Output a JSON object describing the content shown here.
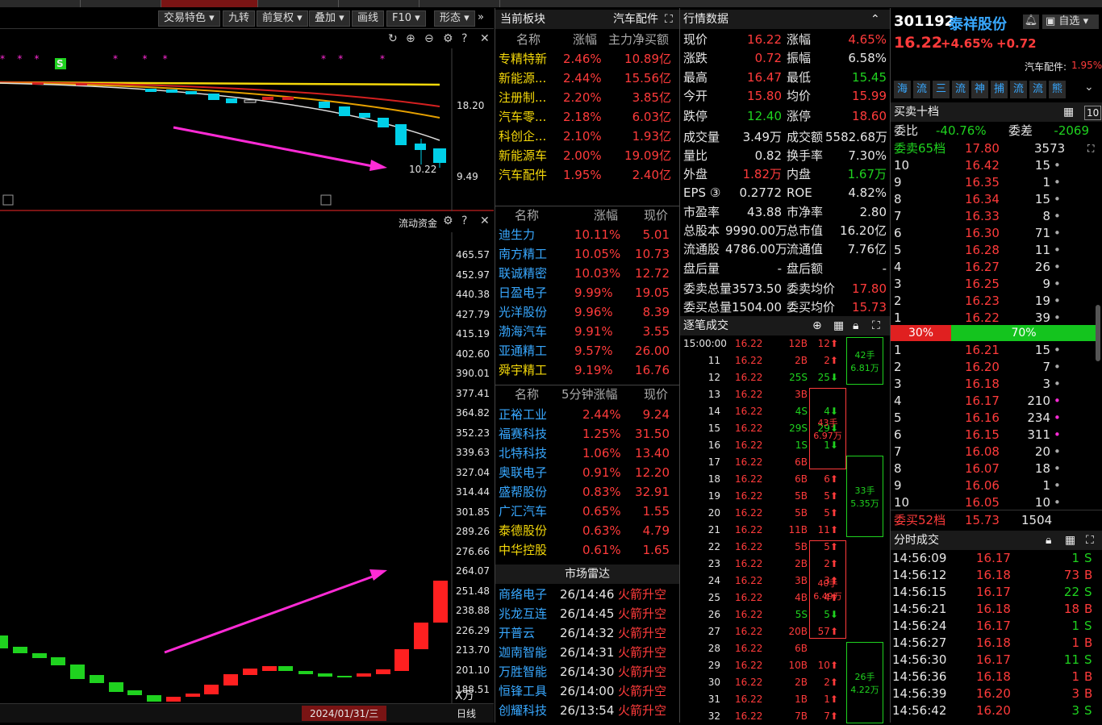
{
  "chart_toolbar": {
    "buttons": [
      "交易特色 ▾",
      "九转",
      "前复权 ▾",
      "叠加 ▾",
      "画线",
      "F10 ▾",
      "形态 ▾"
    ],
    "more": "»"
  },
  "kline": {
    "price_high": "18.20",
    "price_low": "9.49",
    "low_label": "10.22",
    "signal": "S",
    "scale_left_axis": true
  },
  "flow": {
    "title": "流动资金",
    "axis": [
      "465.57",
      "452.97",
      "440.38",
      "427.79",
      "415.19",
      "402.60",
      "390.01",
      "377.41",
      "364.82",
      "352.23",
      "339.63",
      "327.04",
      "314.44",
      "301.85",
      "289.26",
      "276.66",
      "264.07",
      "251.48",
      "238.88",
      "226.29",
      "213.70",
      "201.10",
      "188.51"
    ],
    "unit": "X万"
  },
  "bottom": {
    "date": "2024/01/31/三",
    "period": "日线"
  },
  "sector": {
    "title": "当前板块",
    "current": "汽车配件",
    "cols": [
      "名称",
      "涨幅",
      "主力净买额"
    ],
    "rows": [
      [
        "专精特新",
        "2.46%",
        "10.89亿"
      ],
      [
        "新能源...",
        "2.44%",
        "15.56亿"
      ],
      [
        "注册制...",
        "2.20%",
        "3.85亿"
      ],
      [
        "汽车零...",
        "2.18%",
        "6.03亿"
      ],
      [
        "科创企...",
        "2.10%",
        "1.93亿"
      ],
      [
        "新能源车",
        "2.00%",
        "19.09亿"
      ],
      [
        "汽车配件",
        "1.95%",
        "2.40亿"
      ]
    ]
  },
  "top_gainers": {
    "cols": [
      "名称",
      "涨幅",
      "现价"
    ],
    "rows": [
      [
        "迪生力",
        "10.11%",
        "5.01"
      ],
      [
        "南方精工",
        "10.05%",
        "10.73"
      ],
      [
        "联诚精密",
        "10.03%",
        "12.72"
      ],
      [
        "日盈电子",
        "9.99%",
        "19.05"
      ],
      [
        "光洋股份",
        "9.96%",
        "8.39"
      ],
      [
        "渤海汽车",
        "9.91%",
        "3.55"
      ],
      [
        "亚通精工",
        "9.57%",
        "26.00"
      ],
      [
        "舜宇精工",
        "9.19%",
        "16.76"
      ]
    ]
  },
  "five_min": {
    "cols": [
      "名称",
      "5分钟涨幅",
      "现价"
    ],
    "rows": [
      [
        "正裕工业",
        "2.44%",
        "9.24"
      ],
      [
        "福赛科技",
        "1.25%",
        "31.50"
      ],
      [
        "北特科技",
        "1.06%",
        "13.40"
      ],
      [
        "奥联电子",
        "0.91%",
        "12.20"
      ],
      [
        "盛帮股份",
        "0.83%",
        "32.91"
      ],
      [
        "广汇汽车",
        "0.65%",
        "1.55"
      ],
      [
        "泰德股份",
        "0.63%",
        "4.79"
      ],
      [
        "中华控股",
        "0.61%",
        "1.65"
      ]
    ]
  },
  "radar": {
    "title": "市场雷达",
    "rows": [
      [
        "商络电子",
        "26/14:46",
        "火箭升空"
      ],
      [
        "兆龙互连",
        "26/14:45",
        "火箭升空"
      ],
      [
        "开普云",
        "26/14:32",
        "火箭升空"
      ],
      [
        "迦南智能",
        "26/14:31",
        "火箭升空"
      ],
      [
        "万胜智能",
        "26/14:30",
        "火箭升空"
      ],
      [
        "恒锋工具",
        "26/14:00",
        "火箭升空"
      ],
      [
        "创耀科技",
        "26/13:54",
        "火箭升空"
      ]
    ]
  },
  "quote": {
    "title": "行情数据",
    "rows": [
      [
        "现价",
        "16.22",
        "涨幅",
        "4.65%"
      ],
      [
        "涨跌",
        "0.72",
        "振幅",
        "6.58%"
      ],
      [
        "最高",
        "16.47",
        "最低",
        "15.45"
      ],
      [
        "今开",
        "15.80",
        "均价",
        "15.99"
      ],
      [
        "跌停",
        "12.40",
        "涨停",
        "18.60"
      ],
      [
        "成交量",
        "3.49万",
        "成交额",
        "5582.68万"
      ],
      [
        "量比",
        "0.82",
        "换手率",
        "7.30%"
      ],
      [
        "外盘",
        "1.82万",
        "内盘",
        "1.67万"
      ],
      [
        "EPS ③",
        "0.2772",
        "ROE",
        "4.82%"
      ],
      [
        "市盈率",
        "43.88",
        "市净率",
        "2.80"
      ],
      [
        "总股本",
        "9990.00万",
        "总市值",
        "16.20亿"
      ],
      [
        "流通股",
        "4786.00万",
        "流通值",
        "7.76亿"
      ],
      [
        "盘后量",
        "-",
        "盘后额",
        "-"
      ],
      [
        "委卖总量",
        "3573.50",
        "委卖均价",
        "17.80"
      ],
      [
        "委买总量",
        "1504.00",
        "委买均价",
        "15.73"
      ]
    ]
  },
  "ticks": {
    "title": "逐笔成交",
    "rows": [
      [
        "15:00:00",
        "16.22",
        "12B",
        "12⬆"
      ],
      [
        "11",
        "16.22",
        "2B",
        "2⬆"
      ],
      [
        "12",
        "16.22",
        "25S",
        "25⬇"
      ],
      [
        "13",
        "16.22",
        "3B",
        ""
      ],
      [
        "14",
        "16.22",
        "4S",
        "4⬇"
      ],
      [
        "15",
        "16.22",
        "29S",
        "29⬇"
      ],
      [
        "16",
        "16.22",
        "1S",
        "1⬇"
      ],
      [
        "17",
        "16.22",
        "6B",
        ""
      ],
      [
        "18",
        "16.22",
        "6B",
        "6⬆"
      ],
      [
        "19",
        "16.22",
        "5B",
        "5⬆"
      ],
      [
        "20",
        "16.22",
        "5B",
        "5⬆"
      ],
      [
        "21",
        "16.22",
        "11B",
        "11⬆"
      ],
      [
        "22",
        "16.22",
        "5B",
        "5⬆"
      ],
      [
        "23",
        "16.22",
        "2B",
        "2⬆"
      ],
      [
        "24",
        "16.22",
        "3B",
        "3⬆"
      ],
      [
        "25",
        "16.22",
        "4B",
        "4⬆"
      ],
      [
        "26",
        "16.22",
        "5S",
        "5⬇"
      ],
      [
        "27",
        "16.22",
        "20B",
        "57⬆"
      ],
      [
        "28",
        "16.22",
        "6B",
        ""
      ],
      [
        "29",
        "16.22",
        "10B",
        "10⬆"
      ],
      [
        "30",
        "16.22",
        "2B",
        "2⬆"
      ],
      [
        "31",
        "16.22",
        "1B",
        "1⬆"
      ],
      [
        "32",
        "16.22",
        "7B",
        "7⬆"
      ]
    ],
    "boxes": [
      {
        "l1": "42手",
        "l2": "6.81万",
        "side": "r"
      },
      {
        "l1": "43手",
        "l2": "6.97万",
        "side": "l"
      },
      {
        "l1": "33手",
        "l2": "5.35万",
        "side": "r"
      },
      {
        "l1": "40手",
        "l2": "6.49万",
        "side": "l"
      },
      {
        "l1": "26手",
        "l2": "4.22万",
        "side": "r"
      }
    ]
  },
  "stock": {
    "code": "301192",
    "name": "泰祥股份",
    "watch": "自选",
    "price": "16.22",
    "pct": "+4.65%",
    "chg": "+0.72",
    "sector": "汽车配件:",
    "sector_pct": "1.95%",
    "tags": [
      "海",
      "流",
      "三",
      "流",
      "神",
      "捕",
      "流",
      "流",
      "熊"
    ]
  },
  "book": {
    "title": "买卖十档",
    "ratio_label": "委比",
    "ratio": "-40.76%",
    "diff_label": "委差",
    "diff": "-2069",
    "ask_total_label": "委卖65档",
    "ask_total_price": "17.80",
    "ask_total_vol": "3573",
    "asks": [
      [
        "10",
        "16.42",
        "15"
      ],
      [
        "9",
        "16.35",
        "1"
      ],
      [
        "8",
        "16.34",
        "15"
      ],
      [
        "7",
        "16.33",
        "8"
      ],
      [
        "6",
        "16.30",
        "71"
      ],
      [
        "5",
        "16.28",
        "11"
      ],
      [
        "4",
        "16.27",
        "26"
      ],
      [
        "3",
        "16.25",
        "9"
      ],
      [
        "2",
        "16.23",
        "19"
      ],
      [
        "1",
        "16.22",
        "39"
      ]
    ],
    "sell_pct": "30%",
    "buy_pct": "70%",
    "bids": [
      [
        "1",
        "16.21",
        "15"
      ],
      [
        "2",
        "16.20",
        "7"
      ],
      [
        "3",
        "16.18",
        "3"
      ],
      [
        "4",
        "16.17",
        "210"
      ],
      [
        "5",
        "16.16",
        "234"
      ],
      [
        "6",
        "16.15",
        "311"
      ],
      [
        "7",
        "16.08",
        "20"
      ],
      [
        "8",
        "16.07",
        "18"
      ],
      [
        "9",
        "16.06",
        "1"
      ],
      [
        "10",
        "16.05",
        "10"
      ]
    ],
    "bid_total_label": "委买52档",
    "bid_total_price": "15.73",
    "bid_total_vol": "1504"
  },
  "minute": {
    "title": "分时成交",
    "rows": [
      [
        "14:56:09",
        "16.17",
        "1",
        "S"
      ],
      [
        "14:56:12",
        "16.18",
        "73",
        "B"
      ],
      [
        "14:56:15",
        "16.17",
        "22",
        "S"
      ],
      [
        "14:56:21",
        "16.18",
        "18",
        "B"
      ],
      [
        "14:56:24",
        "16.17",
        "1",
        "S"
      ],
      [
        "14:56:27",
        "16.18",
        "1",
        "B"
      ],
      [
        "14:56:30",
        "16.17",
        "11",
        "S"
      ],
      [
        "14:56:36",
        "16.18",
        "1",
        "B"
      ],
      [
        "14:56:39",
        "16.20",
        "3",
        "B"
      ],
      [
        "14:56:42",
        "16.20",
        "3",
        "S"
      ]
    ]
  }
}
